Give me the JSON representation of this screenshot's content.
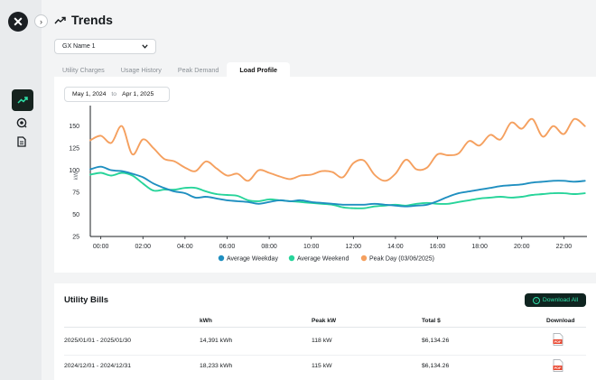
{
  "app": {
    "logo_glyph": "✕",
    "collapse_glyph": "›",
    "page_title": "Trends",
    "title_icon": "trend-arrow-icon"
  },
  "sidebar": {
    "items": [
      {
        "name": "trends",
        "icon": "trend-arrow-icon",
        "active": true
      },
      {
        "name": "utility",
        "icon": "plug-gear-icon",
        "active": false
      },
      {
        "name": "reports",
        "icon": "document-icon",
        "active": false
      }
    ]
  },
  "gx_select": {
    "value": "GX Name 1"
  },
  "tabs": [
    {
      "label": "Utility Charges",
      "active": false
    },
    {
      "label": "Usage History",
      "active": false
    },
    {
      "label": "Peak Demand",
      "active": false
    },
    {
      "label": "Load Profile",
      "active": true
    }
  ],
  "date_range": {
    "start": "May 1, 2024",
    "separator": "to",
    "end": "Apr 1, 2025"
  },
  "colors": {
    "weekday": "#1f8fc0",
    "weekend": "#27d49a",
    "peak": "#f5a05f",
    "accent": "#2fe0a8",
    "dark": "#0f2420"
  },
  "chart_data": {
    "type": "line",
    "title": "",
    "xlabel": "",
    "ylabel": "kW",
    "x_ticks": [
      "00:00",
      "02:00",
      "04:00",
      "06:00",
      "08:00",
      "10:00",
      "12:00",
      "14:00",
      "16:00",
      "18:00",
      "20:00",
      "22:00"
    ],
    "y_ticks": [
      25,
      50,
      75,
      100,
      125,
      150
    ],
    "xlim": [
      -0.5,
      23.1
    ],
    "ylim": [
      25,
      165
    ],
    "legend_position": "bottom",
    "series": [
      {
        "name": "Average Weekday",
        "color": "#1f8fc0",
        "x": [
          -0.5,
          0,
          0.5,
          1,
          1.5,
          2,
          2.5,
          3,
          3.5,
          4,
          4.5,
          5,
          5.5,
          6,
          6.5,
          7,
          7.5,
          8,
          8.5,
          9,
          9.5,
          10,
          10.5,
          11,
          11.5,
          12,
          12.5,
          13,
          13.5,
          14,
          14.5,
          15,
          15.5,
          16,
          16.5,
          17,
          17.5,
          18,
          18.5,
          19,
          19.5,
          20,
          20.5,
          21,
          21.5,
          22,
          22.5,
          23
        ],
        "y": [
          101,
          104,
          100,
          99,
          96,
          92,
          85,
          80,
          76,
          74,
          69,
          70,
          68,
          66,
          65,
          64,
          62,
          64,
          66,
          65,
          66,
          64,
          63,
          62,
          61,
          61,
          61,
          62,
          61,
          60,
          59,
          60,
          61,
          65,
          70,
          74,
          76,
          78,
          80,
          82,
          83,
          84,
          86,
          87,
          88,
          88,
          87,
          88
        ]
      },
      {
        "name": "Average Weekend",
        "color": "#27d49a",
        "x": [
          -0.5,
          0,
          0.5,
          1,
          1.5,
          2,
          2.5,
          3,
          3.5,
          4,
          4.5,
          5,
          5.5,
          6,
          6.5,
          7,
          7.5,
          8,
          8.5,
          9,
          9.5,
          10,
          10.5,
          11,
          11.5,
          12,
          12.5,
          13,
          13.5,
          14,
          14.5,
          15,
          15.5,
          16,
          16.5,
          17,
          17.5,
          18,
          18.5,
          19,
          19.5,
          20,
          20.5,
          21,
          21.5,
          22,
          22.5,
          23
        ],
        "y": [
          95,
          97,
          94,
          97,
          94,
          85,
          77,
          78,
          78,
          80,
          80,
          76,
          73,
          72,
          71,
          66,
          65,
          67,
          66,
          65,
          64,
          63,
          62,
          61,
          58,
          57,
          57,
          59,
          60,
          61,
          60,
          62,
          63,
          62,
          62,
          64,
          66,
          68,
          69,
          70,
          69,
          70,
          72,
          73,
          74,
          74,
          73,
          74
        ]
      },
      {
        "name": "Peak Day (03/06/2025)",
        "color": "#f5a05f",
        "x": [
          -0.5,
          0,
          0.5,
          1,
          1.5,
          2,
          2.5,
          3,
          3.5,
          4,
          4.5,
          5,
          5.5,
          6,
          6.5,
          7,
          7.5,
          8,
          8.5,
          9,
          9.5,
          10,
          10.5,
          11,
          11.5,
          12,
          12.5,
          13,
          13.5,
          14,
          14.5,
          15,
          15.5,
          16,
          16.5,
          17,
          17.5,
          18,
          18.5,
          19,
          19.5,
          20,
          20.5,
          21,
          21.5,
          22,
          22.5,
          23
        ],
        "y": [
          134,
          139,
          131,
          150,
          118,
          135,
          125,
          113,
          110,
          103,
          99,
          110,
          102,
          94,
          96,
          88,
          100,
          97,
          93,
          90,
          94,
          95,
          99,
          98,
          92,
          108,
          111,
          95,
          88,
          96,
          112,
          101,
          103,
          118,
          117,
          119,
          133,
          128,
          140,
          135,
          154,
          147,
          158,
          138,
          150,
          141,
          158,
          150
        ]
      }
    ]
  },
  "bills": {
    "title": "Utility Bills",
    "download_all_label": "Download All",
    "columns": [
      "kWh",
      "Peak kW",
      "Total $",
      "Download"
    ],
    "rows": [
      {
        "period": "2025/01/01 - 2025/01/30",
        "kwh": "14,391 kWh",
        "peak_kw": "118 kW",
        "total": "$6,134.26",
        "file": "PDF"
      },
      {
        "period": "2024/12/01 - 2024/12/31",
        "kwh": "18,233 kWh",
        "peak_kw": "115 kW",
        "total": "$6,134.26",
        "file": "PDF"
      }
    ]
  }
}
